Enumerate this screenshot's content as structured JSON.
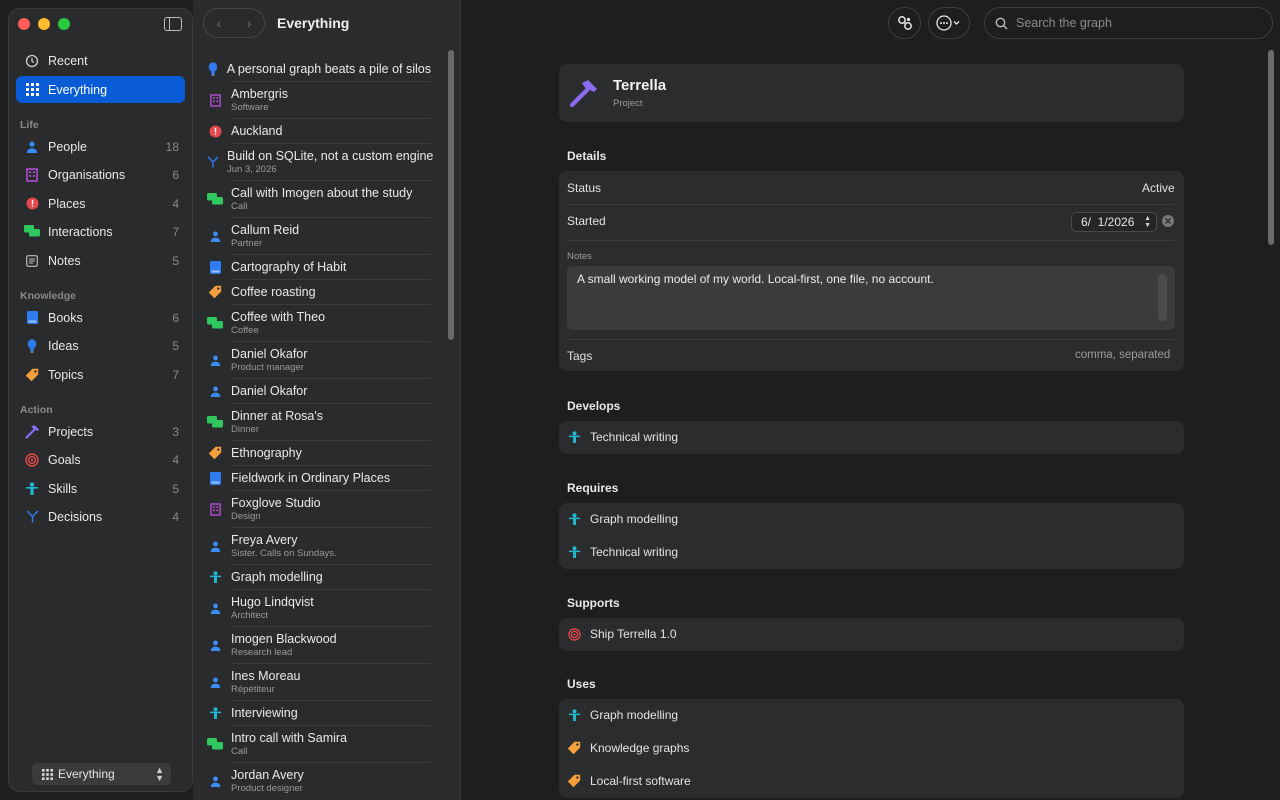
{
  "colors": {
    "accent": "#0a5cd6",
    "traffic": [
      "#ff5f57",
      "#febc2e",
      "#28c840"
    ]
  },
  "sidebar": {
    "top_items": [
      {
        "label": "Recent",
        "icon": "clock-icon",
        "count": ""
      },
      {
        "label": "Everything",
        "icon": "grid-icon",
        "count": "",
        "active": true
      }
    ],
    "groups": [
      {
        "label": "Life",
        "items": [
          {
            "label": "People",
            "icon": "person-icon",
            "count": "18"
          },
          {
            "label": "Organisations",
            "icon": "building-icon",
            "count": "6"
          },
          {
            "label": "Places",
            "icon": "pin-icon",
            "count": "4"
          },
          {
            "label": "Interactions",
            "icon": "chat-icon",
            "count": "7"
          },
          {
            "label": "Notes",
            "icon": "note-icon",
            "count": "5"
          }
        ]
      },
      {
        "label": "Knowledge",
        "items": [
          {
            "label": "Books",
            "icon": "book-icon",
            "count": "6"
          },
          {
            "label": "Ideas",
            "icon": "bulb-icon",
            "count": "5"
          },
          {
            "label": "Topics",
            "icon": "tag-icon",
            "count": "7"
          }
        ]
      },
      {
        "label": "Action",
        "items": [
          {
            "label": "Projects",
            "icon": "hammer-icon",
            "count": "3"
          },
          {
            "label": "Goals",
            "icon": "target-icon",
            "count": "4"
          },
          {
            "label": "Skills",
            "icon": "skill-icon",
            "count": "5"
          },
          {
            "label": "Decisions",
            "icon": "decision-icon",
            "count": "4"
          }
        ]
      }
    ],
    "scope_label": "Everything"
  },
  "list": {
    "title": "Everything",
    "items": [
      {
        "title": "A personal graph beats a pile of silos",
        "sub": "",
        "icon": "bulb-icon"
      },
      {
        "title": "Ambergris",
        "sub": "Software",
        "icon": "building-icon"
      },
      {
        "title": "Auckland",
        "sub": "",
        "icon": "pin-icon"
      },
      {
        "title": "Build on SQLite, not a custom engine",
        "sub": "Jun 3, 2026",
        "icon": "decision-icon"
      },
      {
        "title": "Call with Imogen about the study",
        "sub": "Call",
        "icon": "chat-icon"
      },
      {
        "title": "Callum Reid",
        "sub": "Partner",
        "icon": "person-icon"
      },
      {
        "title": "Cartography of Habit",
        "sub": "",
        "icon": "book-icon"
      },
      {
        "title": "Coffee roasting",
        "sub": "",
        "icon": "tag-icon"
      },
      {
        "title": "Coffee with Theo",
        "sub": "Coffee",
        "icon": "chat-icon"
      },
      {
        "title": "Daniel Okafor",
        "sub": "Product manager",
        "icon": "person-icon"
      },
      {
        "title": "Daniel Okafor",
        "sub": "",
        "icon": "person-icon"
      },
      {
        "title": "Dinner at Rosa's",
        "sub": "Dinner",
        "icon": "chat-icon"
      },
      {
        "title": "Ethnography",
        "sub": "",
        "icon": "tag-icon"
      },
      {
        "title": "Fieldwork in Ordinary Places",
        "sub": "",
        "icon": "book-icon"
      },
      {
        "title": "Foxglove Studio",
        "sub": "Design",
        "icon": "building-icon"
      },
      {
        "title": "Freya Avery",
        "sub": "Sister. Calls on Sundays.",
        "icon": "person-icon"
      },
      {
        "title": "Graph modelling",
        "sub": "",
        "icon": "skill-icon"
      },
      {
        "title": "Hugo Lindqvist",
        "sub": "Architect",
        "icon": "person-icon"
      },
      {
        "title": "Imogen Blackwood",
        "sub": "Research lead",
        "icon": "person-icon"
      },
      {
        "title": "Ines Moreau",
        "sub": "Répétiteur",
        "icon": "person-icon"
      },
      {
        "title": "Interviewing",
        "sub": "",
        "icon": "skill-icon"
      },
      {
        "title": "Intro call with Samira",
        "sub": "Call",
        "icon": "chat-icon"
      },
      {
        "title": "Jordan Avery",
        "sub": "Product designer",
        "icon": "person-icon"
      }
    ]
  },
  "toolbar": {
    "search_placeholder": "Search the graph"
  },
  "detail": {
    "title": "Terrella",
    "kind": "Project",
    "details_heading": "Details",
    "status_label": "Status",
    "status_value": "Active",
    "started_label": "Started",
    "started_value": "6/  1/2026",
    "notes_label": "Notes",
    "notes_value": "A small working model of my world. Local-first, one file, no account.",
    "tags_label": "Tags",
    "tags_placeholder": "comma, separated",
    "relations": [
      {
        "heading": "Develops",
        "items": [
          {
            "label": "Technical writing",
            "icon": "skill-icon"
          }
        ]
      },
      {
        "heading": "Requires",
        "items": [
          {
            "label": "Graph modelling",
            "icon": "skill-icon"
          },
          {
            "label": "Technical writing",
            "icon": "skill-icon"
          }
        ]
      },
      {
        "heading": "Supports",
        "items": [
          {
            "label": "Ship Terrella 1.0",
            "icon": "target-icon"
          }
        ]
      },
      {
        "heading": "Uses",
        "items": [
          {
            "label": "Graph modelling",
            "icon": "skill-icon"
          },
          {
            "label": "Knowledge graphs",
            "icon": "tag-icon"
          },
          {
            "label": "Local-first software",
            "icon": "tag-icon"
          }
        ]
      }
    ]
  }
}
